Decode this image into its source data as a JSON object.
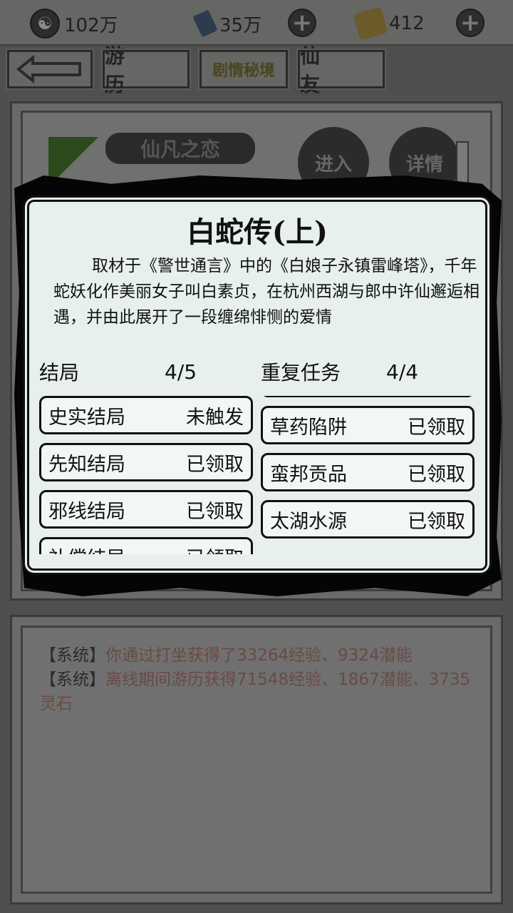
{
  "resources": {
    "silver": "102万",
    "gems": "35万",
    "scrolls": "412",
    "plus": "+"
  },
  "tabs": [
    {
      "label": "游 历"
    },
    {
      "label": "剧情秘境"
    },
    {
      "label": "仙 友"
    }
  ],
  "story_card": {
    "title": "仙凡之恋",
    "enter": "进入",
    "detail": "详情"
  },
  "modal": {
    "title": "白蛇传(上)",
    "description": "取材于《警世通言》中的《白娘子永镇雷峰塔》，千年蛇妖化作美丽女子叫白素贞，在杭州西湖与郎中许仙邂逅相遇，并由此展开了一段缠绵悱恻的爱情",
    "endings": {
      "header": "结局",
      "count": "4/5",
      "items": [
        {
          "name": "史实结局",
          "status": "未触发"
        },
        {
          "name": "先知结局",
          "status": "已领取"
        },
        {
          "name": "邪线结局",
          "status": "已领取"
        },
        {
          "name": "补偿结局",
          "status": "已领取"
        }
      ]
    },
    "repeat_tasks": {
      "header": "重复任务",
      "count": "4/4",
      "items": [
        {
          "name": "草药陷阱",
          "status": "已领取"
        },
        {
          "name": "蛮邦贡品",
          "status": "已领取"
        },
        {
          "name": "太湖水源",
          "status": "已领取"
        }
      ]
    }
  },
  "log": {
    "lines": [
      {
        "tag": "【系统】",
        "text": "你通过打坐获得了33264经验、9324潜能"
      },
      {
        "tag": "【系统】",
        "text": "离线期间游历获得71548经验、1867潜能、3735灵石"
      }
    ]
  },
  "colors": {
    "overlay_dim": "#4f4f4d",
    "modal_bg": "#e7f0ef",
    "log_text": "#6a4a44"
  }
}
